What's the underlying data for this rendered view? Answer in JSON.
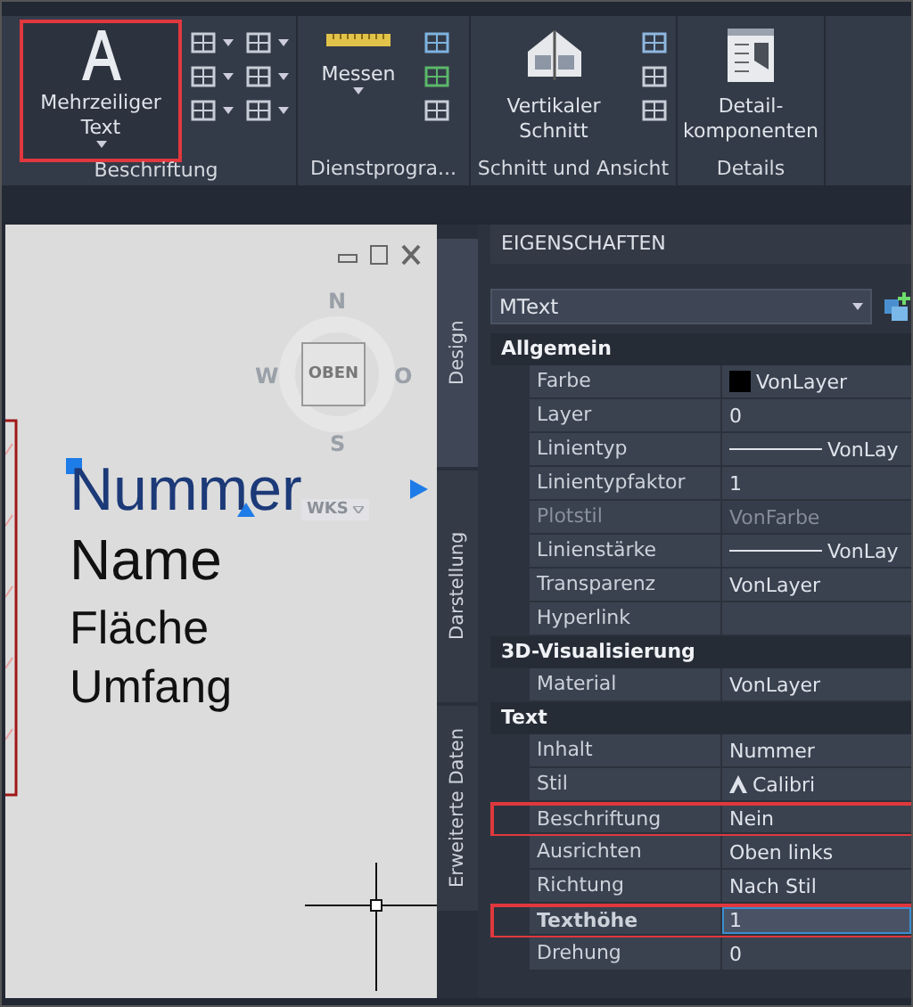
{
  "ribbon": {
    "panels": [
      {
        "kind": "annotation",
        "title": "Beschriftung",
        "button": {
          "label": "Mehrzeiliger Text",
          "highlighted": true,
          "dropdown": true
        }
      },
      {
        "kind": "utilities",
        "title": "Dienstprogra...",
        "button": {
          "label": "Messen",
          "highlighted": false,
          "dropdown": true
        }
      },
      {
        "kind": "section",
        "title": "Schnitt und Ansicht",
        "button": {
          "label": "Vertikaler Schnitt",
          "highlighted": false,
          "dropdown": false
        }
      },
      {
        "kind": "details",
        "title": "Details",
        "button": {
          "label": "Detail-komponenten",
          "highlighted": false,
          "dropdown": false
        }
      }
    ]
  },
  "drawing": {
    "viewcube": {
      "face": "OBEN",
      "north": "N",
      "west": "W",
      "east": "O",
      "south": "S",
      "ucs": "WKS"
    },
    "texts": [
      {
        "text": "Nummer",
        "selected": true
      },
      {
        "text": "Name",
        "selected": false
      },
      {
        "text": "Fläche",
        "selected": false
      },
      {
        "text": "Umfang",
        "selected": false
      }
    ]
  },
  "side_tabs": [
    {
      "label": "Design",
      "selected": true
    },
    {
      "label": "Darstellung",
      "selected": false
    },
    {
      "label": "Erweiterte Daten",
      "selected": false
    }
  ],
  "properties": {
    "title": "EIGENSCHAFTEN",
    "object_type": "MText",
    "sections": [
      {
        "title": "Allgemein",
        "rows": [
          {
            "label": "Farbe",
            "value": "VonLayer",
            "kind": "color",
            "disabled": false,
            "highlighted": false,
            "active": false
          },
          {
            "label": "Layer",
            "value": "0",
            "kind": "text",
            "disabled": false,
            "highlighted": false,
            "active": false
          },
          {
            "label": "Linientyp",
            "value": "VonLay",
            "kind": "line",
            "disabled": false,
            "highlighted": false,
            "active": false
          },
          {
            "label": "Linientypfaktor",
            "value": "1",
            "kind": "text",
            "disabled": false,
            "highlighted": false,
            "active": false
          },
          {
            "label": "Plotstil",
            "value": "VonFarbe",
            "kind": "text",
            "disabled": true,
            "highlighted": false,
            "active": false
          },
          {
            "label": "Linienstärke",
            "value": "VonLay",
            "kind": "line",
            "disabled": false,
            "highlighted": false,
            "active": false
          },
          {
            "label": "Transparenz",
            "value": "VonLayer",
            "kind": "text",
            "disabled": false,
            "highlighted": false,
            "active": false
          },
          {
            "label": "Hyperlink",
            "kind": "empty",
            "disabled": false,
            "highlighted": false,
            "active": false
          }
        ]
      },
      {
        "title": "3D-Visualisierung",
        "rows": [
          {
            "label": "Material",
            "value": "VonLayer",
            "kind": "text",
            "disabled": false,
            "highlighted": false,
            "active": false
          }
        ]
      },
      {
        "title": "Text",
        "rows": [
          {
            "label": "Inhalt",
            "value": "Nummer",
            "kind": "text",
            "disabled": false,
            "highlighted": false,
            "active": false
          },
          {
            "label": "Stil",
            "value": "Calibri",
            "kind": "font",
            "disabled": false,
            "highlighted": false,
            "active": false
          },
          {
            "label": "Beschriftung",
            "value": "Nein",
            "kind": "text",
            "disabled": false,
            "highlighted": true,
            "active": false
          },
          {
            "label": "Ausrichten",
            "value": "Oben links",
            "kind": "text",
            "disabled": false,
            "highlighted": false,
            "active": false
          },
          {
            "label": "Richtung",
            "value": "Nach Stil",
            "kind": "text",
            "disabled": false,
            "highlighted": false,
            "active": false
          },
          {
            "label": "Texthöhe",
            "value": "1",
            "kind": "text",
            "disabled": false,
            "highlighted": true,
            "active": true
          },
          {
            "label": "Drehung",
            "value": "0",
            "kind": "text",
            "disabled": false,
            "highlighted": false,
            "active": false
          }
        ]
      }
    ]
  }
}
